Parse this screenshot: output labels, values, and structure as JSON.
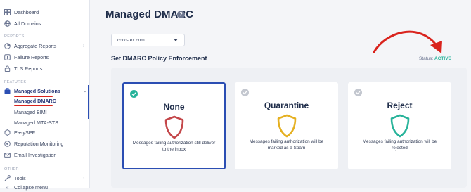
{
  "sidebar": {
    "dashboard": "Dashboard",
    "all_domains": "All Domains",
    "reports_label": "REPORTS",
    "aggregate_reports": "Aggregate Reports",
    "failure_reports": "Failure Reports",
    "tls_reports": "TLS Reports",
    "features_label": "FEATURES",
    "managed_solutions": "Managed Solutions",
    "managed_dmarc": "Managed DMARC",
    "managed_bimi": "Managed BIMI",
    "managed_mta_sts": "Managed MTA-STS",
    "easyspf": "EasySPF",
    "reputation_monitoring": "Reputation Monitoring",
    "email_investigation": "Email Investigation",
    "other_label": "OTHER",
    "tools": "Tools",
    "collapse_menu": "Collapse menu"
  },
  "header": {
    "title": "Managed DMARC",
    "help_icon_text": "?"
  },
  "domain_select": {
    "value": "coco-tex.com"
  },
  "policy": {
    "section_title": "Set DMARC Policy Enforcement",
    "status_label": "Status:",
    "status_value": "ACTIVE",
    "cards": [
      {
        "title": "None",
        "description": "Messages failing authorization still deliver to the inbox",
        "selected": true,
        "shield_color": "#c4474a"
      },
      {
        "title": "Quarantine",
        "description": "Messages failing authorization will be marked as a Spam",
        "selected": false,
        "shield_color": "#e5b021"
      },
      {
        "title": "Reject",
        "description": "Messages failing authorization will be rejected",
        "selected": false,
        "shield_color": "#27b39a"
      }
    ]
  },
  "colors": {
    "accent": "#2b4eb3",
    "active_status": "#27b39a",
    "annotation_red": "#d9231d"
  },
  "icons": [
    "dashboard-icon",
    "globe-icon",
    "chart-icon",
    "alert-icon",
    "lock-icon",
    "briefcase-icon",
    "spf-icon",
    "reputation-icon",
    "mail-icon",
    "tools-icon",
    "help-icon",
    "check-icon",
    "shield-icon",
    "caret-down-icon"
  ]
}
